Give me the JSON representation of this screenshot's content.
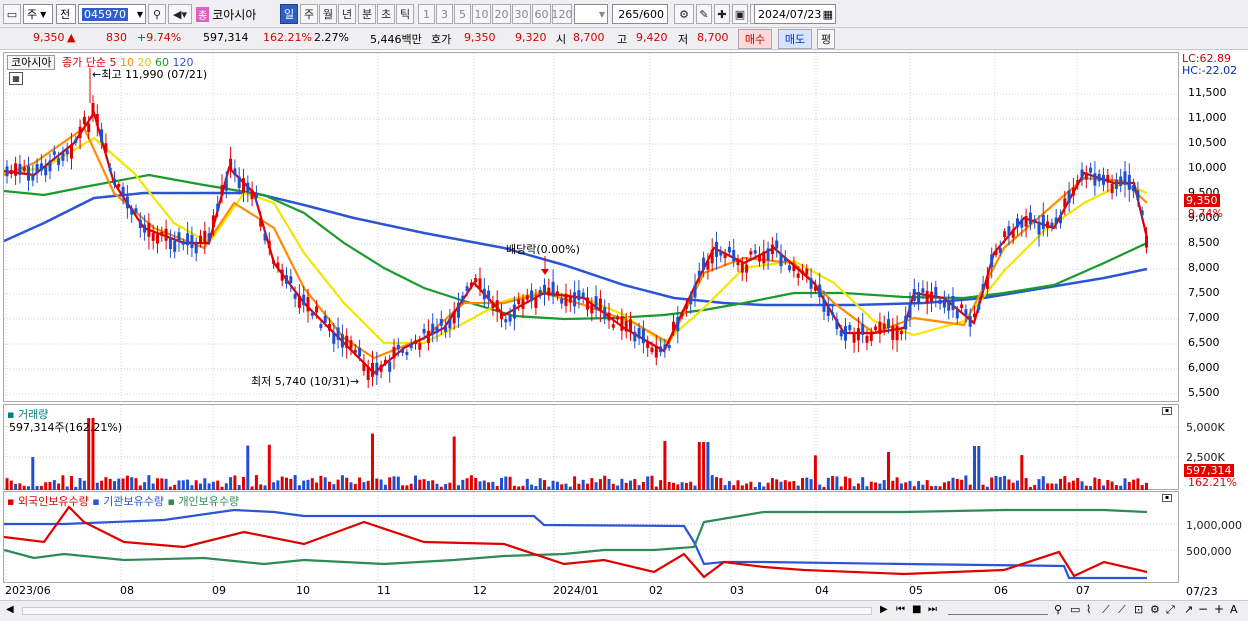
{
  "toolbar": {
    "market_select": "주",
    "view_select": "전",
    "stock_code": "045970",
    "stock_name": "코아시아",
    "stock_badge": "종",
    "periods": [
      "일",
      "주",
      "월",
      "년",
      "분",
      "초",
      "틱"
    ],
    "active_period": "일",
    "intervals": [
      "1",
      "3",
      "5",
      "10",
      "20",
      "30",
      "60",
      "120"
    ],
    "count_value": "265",
    "count_total": "/600",
    "date_value": "2024/07/23"
  },
  "quote": {
    "price": "9,350",
    "change": "830",
    "change_pct": "+9.74%",
    "volume": "597,314",
    "volume_ratio": "162.21%",
    "turnover": "2.27%",
    "amount": "5,446백만",
    "ask_label": "호가",
    "ask": "9,350",
    "bid": "9,320",
    "open_label": "시",
    "open": "8,700",
    "high_label": "고",
    "high": "9,420",
    "low_label": "저",
    "low": "8,700",
    "buy_button": "매수",
    "sell_button": "매도",
    "avg_button": "평"
  },
  "price_chart": {
    "name": "코아시아",
    "ma_label": "종가 단순",
    "ma_periods": [
      "5",
      "10",
      "20",
      "60",
      "120"
    ],
    "ma_colors": [
      "#e00000",
      "#ff8c00",
      "#f2e600",
      "#1a9a2a",
      "#2b55d6"
    ],
    "lc": "LC:62.89",
    "hc": "HC:-22.02",
    "high_note": "최고 11,990 (07/21)",
    "low_note": "최저 5,740 (10/31)",
    "dividend_note": "배당락(0.00%)",
    "current_price_tag": "9,350",
    "current_pct_tag": "9.74%",
    "y_ticks": [
      "11,500",
      "11,000",
      "10,500",
      "10,000",
      "9,500",
      "9,000",
      "8,500",
      "8,000",
      "7,500",
      "7,000",
      "6,500",
      "6,000",
      "5,500"
    ]
  },
  "volume_chart": {
    "title": "거래량",
    "value_note": "597,314주(162.21%)",
    "y_ticks": [
      "5,000K",
      "2,500K"
    ],
    "current_tag": "597,314",
    "current_pct_tag": "162.21%"
  },
  "holding_chart": {
    "legend": [
      "외국인보유수량",
      "기관보유수량",
      "개인보유수량"
    ],
    "legend_colors": [
      "#e00000",
      "#2b55d6",
      "#2e8b57"
    ],
    "y_ticks": [
      "1,000,000",
      "500,000"
    ]
  },
  "x_axis": [
    "2023/06",
    "08",
    "09",
    "10",
    "11",
    "12",
    "2024/01",
    "02",
    "03",
    "04",
    "05",
    "06",
    "07"
  ],
  "x_axis_right": "07/23"
}
